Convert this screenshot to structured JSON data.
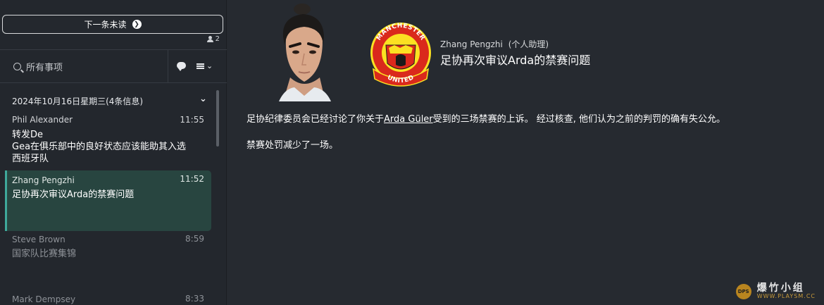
{
  "sidebar": {
    "next_unread_label": "下一条未读",
    "user_count": "2",
    "search_placeholder": "所有事项",
    "date_header": "2024年10月16日星期三(4条信息)",
    "messages": [
      {
        "sender": "Phil Alexander",
        "time": "11:55",
        "subject": [
          "转发De",
          "Gea在俱乐部中的良好状态应该能助其入选",
          "西班牙队"
        ],
        "state": "unread"
      },
      {
        "sender": "Zhang Pengzhi",
        "time": "11:52",
        "subject": [
          "足协再次审议Arda的禁赛问题"
        ],
        "state": "selected"
      },
      {
        "sender": "Steve Brown",
        "time": "8:59",
        "subject": [
          "国家队比赛集锦"
        ],
        "state": "read"
      },
      {
        "sender": "Mark Dempsey",
        "time": "8:33",
        "subject": [],
        "state": "read"
      }
    ]
  },
  "message": {
    "sender_name": "Zhang Pengzhi",
    "sender_role": "(个人助理)",
    "subject": "足协再次审议Arda的禁赛问题",
    "body": {
      "p1_before": "足协纪律委员会已经讨论了你关于",
      "p1_link": "Arda Güler",
      "p1_after": "受到的三场禁赛的上诉。 经过核查, 他们认为之前的判罚的确有失公允。",
      "p2": "禁赛处罚减少了一场。"
    },
    "crest": {
      "top_text": "MANCHESTER",
      "bottom_text": "UNITED"
    }
  },
  "watermark": {
    "title": "爆竹小组",
    "url": "WWW.PLAYSM.CC",
    "logo_text": "DPS"
  },
  "colors": {
    "selected_bg": "#284540",
    "selected_accent": "#3fa89b",
    "crest_red": "#da291c",
    "crest_yellow": "#fbe122"
  },
  "icons": {
    "next": "arrow-right-circle-icon",
    "users": "person-icon",
    "search": "search-icon",
    "chat": "chat-bubble-icon",
    "menu": "list-menu-icon",
    "date_toggle": "chevron-down-icon"
  }
}
